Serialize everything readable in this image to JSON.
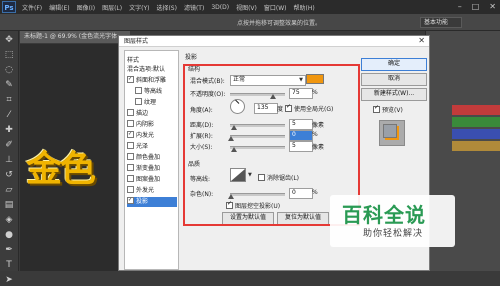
{
  "app": {
    "logo": "Ps",
    "menu": [
      "文件(F)",
      "编辑(E)",
      "图像(I)",
      "图层(L)",
      "文字(Y)",
      "选择(S)",
      "滤镜(T)",
      "3D(D)",
      "视图(V)",
      "窗口(W)",
      "帮助(H)"
    ],
    "option_hint": "点按并拖移可调整效果的位置。",
    "workspace": "基本功能",
    "doc_tab": "未标题-1 @ 69.9% (金色流光字体"
  },
  "canvas": {
    "text": "金色"
  },
  "dialog": {
    "title": "图层样式",
    "styles_header": "样式",
    "styles": [
      {
        "label": "混合选项:默认",
        "checked": false,
        "selected": false,
        "indent": false,
        "nobox": true
      },
      {
        "label": "斜面和浮雕",
        "checked": true,
        "selected": false,
        "indent": false
      },
      {
        "label": "等高线",
        "checked": false,
        "selected": false,
        "indent": true
      },
      {
        "label": "纹理",
        "checked": false,
        "selected": false,
        "indent": true
      },
      {
        "label": "描边",
        "checked": false,
        "selected": false,
        "indent": false
      },
      {
        "label": "内阴影",
        "checked": false,
        "selected": false,
        "indent": false
      },
      {
        "label": "内发光",
        "checked": true,
        "selected": false,
        "indent": false
      },
      {
        "label": "光泽",
        "checked": false,
        "selected": false,
        "indent": false
      },
      {
        "label": "颜色叠加",
        "checked": false,
        "selected": false,
        "indent": false
      },
      {
        "label": "渐变叠加",
        "checked": false,
        "selected": false,
        "indent": false
      },
      {
        "label": "图案叠加",
        "checked": false,
        "selected": false,
        "indent": false
      },
      {
        "label": "外发光",
        "checked": false,
        "selected": false,
        "indent": false
      },
      {
        "label": "投影",
        "checked": true,
        "selected": true,
        "indent": false
      }
    ],
    "panel": {
      "section": "投影",
      "structure": "结构",
      "blend_mode_label": "混合模式(B):",
      "blend_mode": "正常",
      "shadow_color": "#f0960f",
      "opacity_label": "不透明度(O):",
      "opacity": "75",
      "percent": "%",
      "angle_label": "角度(A):",
      "angle": "135",
      "degree": "度",
      "global_light": "使用全局光(G)",
      "distance_label": "距离(D):",
      "distance": "5",
      "spread_label": "扩展(R):",
      "spread": "0",
      "size_label": "大小(S):",
      "size": "5",
      "px": "像素",
      "quality": "品质",
      "contour_label": "等高线:",
      "antialias": "消除锯齿(L)",
      "noise_label": "杂色(N):",
      "noise": "0",
      "knockout": "图层挖空投影(U)",
      "make_default": "设置为默认值",
      "reset_default": "复位为默认值"
    },
    "buttons": {
      "ok": "确定",
      "cancel": "取消",
      "new_style": "新建样式(W)...",
      "preview": "预览(V)"
    }
  },
  "watermark": {
    "main": "百科全说",
    "sub": "助你轻松解决"
  }
}
